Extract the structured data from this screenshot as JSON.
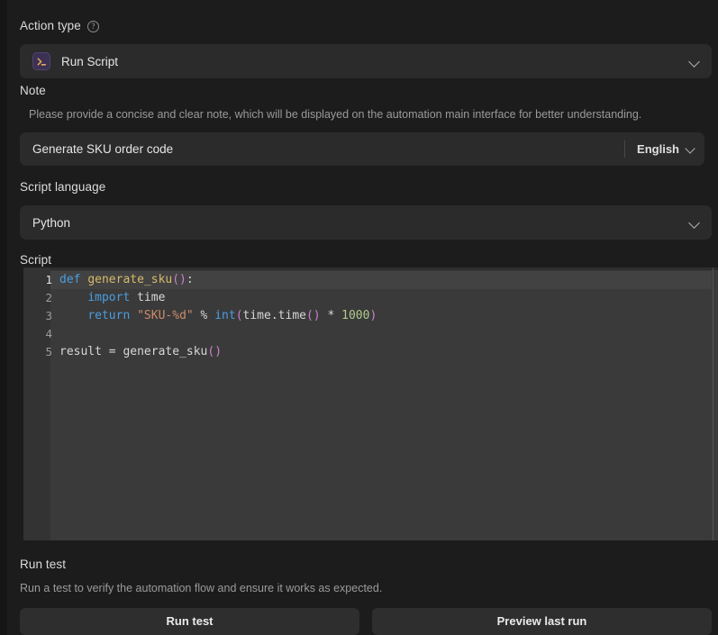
{
  "action_type": {
    "label": "Action type",
    "help_icon": "question-circle-icon",
    "selected": "Run Script",
    "icon": "terminal-prompt-icon",
    "chevron": "chevron-down-icon"
  },
  "note": {
    "label": "Note",
    "description": "Please provide a concise and clear note, which will be displayed on the automation main interface for better understanding.",
    "value": "Generate SKU order code",
    "placeholder": "Generate SKU order code",
    "language": "English",
    "chevron": "chevron-down-icon"
  },
  "script_language": {
    "label": "Script language",
    "selected": "Python",
    "chevron": "chevron-down-icon"
  },
  "script": {
    "label": "Script",
    "active_line": 1,
    "lines": [
      {
        "number": "1",
        "tokens": [
          {
            "t": "def",
            "c": "kw"
          },
          {
            "t": " ",
            "c": "plain"
          },
          {
            "t": "generate_sku",
            "c": "fn"
          },
          {
            "t": "()",
            "c": "punc"
          },
          {
            "t": ":",
            "c": "plain"
          }
        ]
      },
      {
        "number": "2",
        "tokens": [
          {
            "t": "    ",
            "c": "plain"
          },
          {
            "t": "import",
            "c": "kw"
          },
          {
            "t": " time",
            "c": "plain"
          }
        ]
      },
      {
        "number": "3",
        "tokens": [
          {
            "t": "    ",
            "c": "plain"
          },
          {
            "t": "return",
            "c": "kw"
          },
          {
            "t": " ",
            "c": "plain"
          },
          {
            "t": "\"SKU-%d\"",
            "c": "str"
          },
          {
            "t": " % ",
            "c": "op"
          },
          {
            "t": "int",
            "c": "builtin"
          },
          {
            "t": "(",
            "c": "punc"
          },
          {
            "t": "time.time",
            "c": "plain"
          },
          {
            "t": "()",
            "c": "punc"
          },
          {
            "t": " * ",
            "c": "op"
          },
          {
            "t": "1000",
            "c": "num"
          },
          {
            "t": ")",
            "c": "punc"
          }
        ]
      },
      {
        "number": "4",
        "tokens": []
      },
      {
        "number": "5",
        "tokens": [
          {
            "t": "result = ",
            "c": "plain"
          },
          {
            "t": "generate_sku",
            "c": "plain"
          },
          {
            "t": "()",
            "c": "punc"
          }
        ]
      }
    ]
  },
  "run_test": {
    "label": "Run test",
    "description": "Run a test to verify the automation flow and ensure it works as expected.",
    "primary_button": "Run test",
    "secondary_button": "Preview last run"
  },
  "colors": {
    "background": "#1c1c1c",
    "field": "#2b2b2b",
    "editor_bg": "#3a3a3a",
    "gutter": "#333333",
    "keyword": "#4a9ee0",
    "function": "#d7ba6a",
    "punctuation": "#cf7fd0",
    "string": "#cd8b6a",
    "number": "#b2c98a",
    "icon_tile": "#3b3152",
    "icon_glyph": "#e6a85c"
  }
}
